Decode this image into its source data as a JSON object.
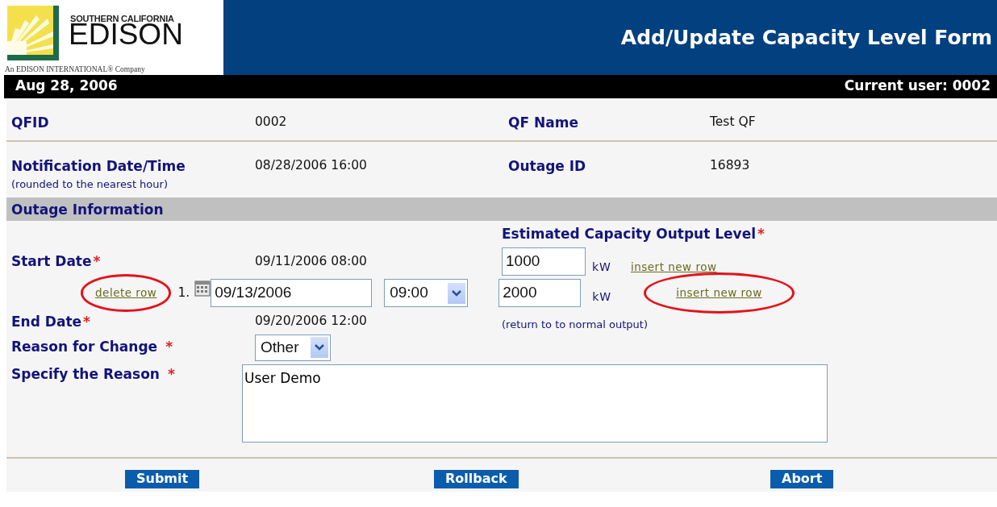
{
  "header": {
    "logo": {
      "top": "SOUTHERN CALIFORNIA",
      "name": "EDISON",
      "tagline": "An EDISON INTERNATIONAL® Company"
    },
    "title": "Add/Update Capacity Level Form"
  },
  "status_bar": {
    "date": "Aug 28, 2006",
    "user": "Current user: 0002"
  },
  "info_rows": [
    {
      "fields": [
        {
          "label": "QFID",
          "value": "0002"
        },
        {
          "label": "QF Name",
          "value": "Test QF"
        }
      ]
    },
    {
      "fields": [
        {
          "label": "Notification Date/Time",
          "note": "(rounded to the nearest hour)",
          "value": "08/28/2006 16:00"
        },
        {
          "label": "Outage ID",
          "value": "16893"
        }
      ]
    }
  ],
  "section": "Outage Information",
  "capacity_heading": {
    "label": "Estimated Capacity Output Level",
    "mark": "*"
  },
  "start": {
    "label": "Start Date",
    "mark": "*",
    "value": "09/11/2006 08:00",
    "capacity": "1000",
    "unit": "kW",
    "link": "insert new row",
    "circled": false
  },
  "steps": [
    {
      "delete": "delete row",
      "delete_circled": true,
      "index": "1.",
      "date": "09/13/2006",
      "time": "09:00",
      "capacity": "2000",
      "unit": "kW",
      "link": "insert new row",
      "link_circled": true
    }
  ],
  "end": {
    "label": "End Date",
    "mark": "*",
    "value": "09/20/2006 12:00",
    "note": "(return to to normal output)"
  },
  "reason": {
    "label": "Reason for Change",
    "mark": "*",
    "value": "Other"
  },
  "specify": {
    "label": "Specify the Reason",
    "mark": "*",
    "value": "User Demo"
  },
  "buttons": [
    "Submit",
    "Rollback",
    "Abort"
  ]
}
